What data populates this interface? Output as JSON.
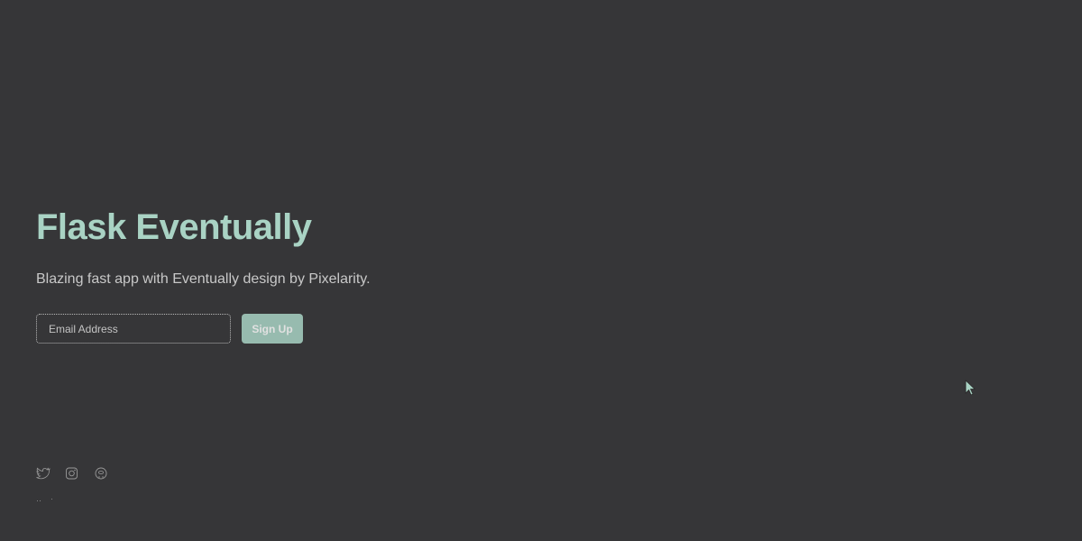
{
  "hero": {
    "title": "Flask Eventually",
    "subtitle": "Blazing fast app with Eventually design by Pixelarity."
  },
  "signup": {
    "email_placeholder": "Email Address",
    "button_label": "Sign Up"
  },
  "colors": {
    "background": "#363638",
    "accent": "#a9d3c4"
  },
  "social_icons": [
    "twitter-icon",
    "instagram-icon",
    "github-icon"
  ]
}
